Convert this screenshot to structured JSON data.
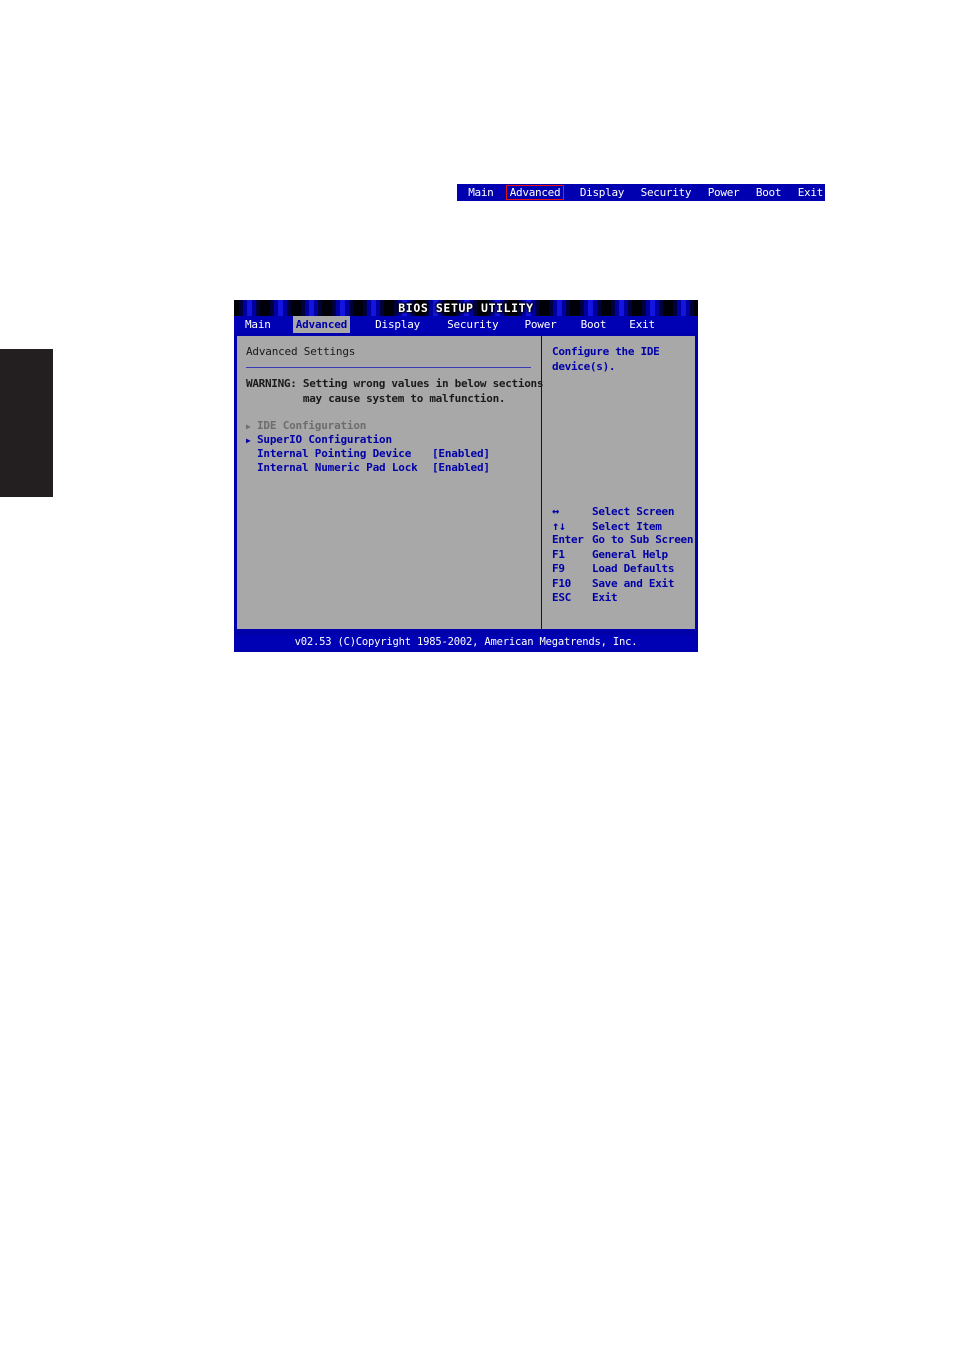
{
  "page_nav": {
    "items": [
      {
        "label": "Main",
        "current": false
      },
      {
        "label": "Advanced",
        "current": true
      },
      {
        "label": "Display",
        "current": false
      },
      {
        "label": "Security",
        "current": false
      },
      {
        "label": "Power",
        "current": false
      },
      {
        "label": "Boot",
        "current": false
      },
      {
        "label": "Exit",
        "current": false
      }
    ],
    "highlight_color": "#e81010",
    "background_color": "#0000b0"
  },
  "bios": {
    "title": "BIOS SETUP UTILITY",
    "tabs": [
      {
        "label": "Main",
        "active": false
      },
      {
        "label": "Advanced",
        "active": true
      },
      {
        "label": "Display",
        "active": false
      },
      {
        "label": "Security",
        "active": false
      },
      {
        "label": "Power",
        "active": false
      },
      {
        "label": "Boot",
        "active": false
      },
      {
        "label": "Exit",
        "active": false
      }
    ],
    "left_panel": {
      "section_title": "Advanced Settings",
      "warning": "WARNING: Setting wrong values in below sections\n         may cause system to malfunction.",
      "menu": [
        {
          "arrow": "▶",
          "label": "IDE Configuration",
          "value": "",
          "selected": true
        },
        {
          "arrow": "▶",
          "label": "SuperIO Configuration",
          "value": "",
          "selected": false
        },
        {
          "arrow": "",
          "label": "Internal Pointing Device",
          "value": "[Enabled]",
          "selected": false
        },
        {
          "arrow": "",
          "label": "Internal Numeric Pad Lock",
          "value": "[Enabled]",
          "selected": false
        }
      ]
    },
    "right_panel": {
      "help_text": "Configure the IDE\ndevice(s).",
      "keys": [
        {
          "key": "↔",
          "desc": "Select Screen",
          "glyph": true
        },
        {
          "key": "↑↓",
          "desc": "Select Item",
          "glyph": true
        },
        {
          "key": "Enter",
          "desc": "Go to Sub Screen",
          "glyph": false
        },
        {
          "key": "F1",
          "desc": "General Help",
          "glyph": false
        },
        {
          "key": "F9",
          "desc": "Load Defaults",
          "glyph": false
        },
        {
          "key": "F10",
          "desc": "Save and Exit",
          "glyph": false
        },
        {
          "key": "ESC",
          "desc": "Exit",
          "glyph": false
        }
      ]
    },
    "footer": "v02.53 (C)Copyright 1985-2002, American Megatrends, Inc."
  }
}
